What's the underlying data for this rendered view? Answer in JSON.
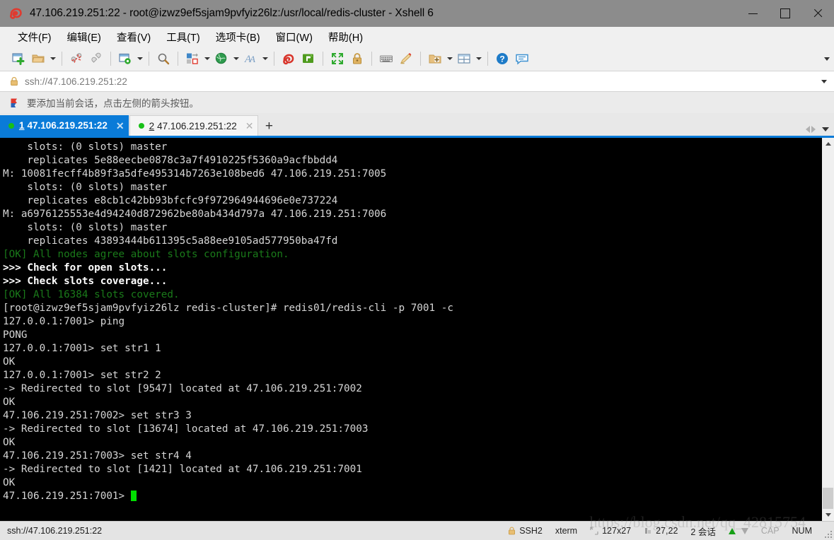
{
  "window": {
    "title": "47.106.219.251:22 - root@izwz9ef5sjam9pvfyiz26lz:/usr/local/redis-cluster - Xshell 6",
    "app_icon": "xshell-logo-icon",
    "minimize_label": "—",
    "maximize_label": "□",
    "close_label": "✕"
  },
  "menu": {
    "items": [
      {
        "label": "文件(F)",
        "name": "menu-file"
      },
      {
        "label": "编辑(E)",
        "name": "menu-edit"
      },
      {
        "label": "查看(V)",
        "name": "menu-view"
      },
      {
        "label": "工具(T)",
        "name": "menu-tools"
      },
      {
        "label": "选项卡(B)",
        "name": "menu-tabs"
      },
      {
        "label": "窗口(W)",
        "name": "menu-window"
      },
      {
        "label": "帮助(H)",
        "name": "menu-help"
      }
    ]
  },
  "toolbar": {
    "overflow_label": "▾",
    "buttons": [
      {
        "icon": "new-session-icon",
        "tooltip": "新建"
      },
      {
        "icon": "open-folder-icon",
        "tooltip": "打开"
      },
      {
        "icon": "disconnect-icon",
        "tooltip": "断开"
      },
      {
        "icon": "reconnect-icon",
        "tooltip": "重新连接"
      },
      {
        "icon": "session-properties-icon",
        "tooltip": "属性"
      },
      {
        "icon": "find-icon",
        "tooltip": "查找"
      },
      {
        "icon": "transfer-icon",
        "tooltip": "传输"
      },
      {
        "icon": "globe-icon",
        "tooltip": "浏览"
      },
      {
        "icon": "font-icon",
        "tooltip": "字体"
      },
      {
        "icon": "xshell-red-icon",
        "tooltip": "Xshell"
      },
      {
        "icon": "xftp-green-icon",
        "tooltip": "Xftp"
      },
      {
        "icon": "fullscreen-icon",
        "tooltip": "全屏"
      },
      {
        "icon": "lock-icon",
        "tooltip": "锁定"
      },
      {
        "icon": "keyboard-icon",
        "tooltip": "键盘"
      },
      {
        "icon": "highlight-pen-icon",
        "tooltip": "高亮"
      },
      {
        "icon": "add-folder-icon",
        "tooltip": "新建文件夹"
      },
      {
        "icon": "layout-split-icon",
        "tooltip": "排列"
      },
      {
        "icon": "help-icon",
        "tooltip": "帮助"
      },
      {
        "icon": "chat-icon",
        "tooltip": "聊天"
      }
    ]
  },
  "address_bar": {
    "icon": "lock-icon",
    "value": "ssh://47.106.219.251:22",
    "placeholder": "ssh://47.106.219.251:22",
    "dropdown_label": "▾"
  },
  "notice": {
    "icon": "bookmark-flag-icon",
    "text": "要添加当前会话，点击左侧的箭头按钮。"
  },
  "tabs": {
    "items": [
      {
        "number": "1",
        "label": "47.106.219.251:22",
        "active": true,
        "close_label": "✕",
        "status": "connected"
      },
      {
        "number": "2",
        "label": "47.106.219.251:22",
        "active": false,
        "close_label": "✕",
        "status": "connected"
      }
    ],
    "new_tab_label": "+",
    "nav_prev_label": "◀",
    "nav_next_label": "▶",
    "list_label": "▾"
  },
  "terminal": {
    "background": "#000000",
    "foreground": "#d6d6d6",
    "green": "#1a7a1a",
    "cursor_color": "#00e000",
    "lines": [
      {
        "text": "    slots: (0 slots) master",
        "color": "white"
      },
      {
        "text": "    replicates 5e88eecbe0878c3a7f4910225f5360a9acfbbdd4",
        "color": "white"
      },
      {
        "text": "M: 10081fecff4b89f3a5dfe495314b7263e108bed6 47.106.219.251:7005",
        "color": "white"
      },
      {
        "text": "    slots: (0 slots) master",
        "color": "white"
      },
      {
        "text": "    replicates e8cb1c42bb93bfcfc9f972964944696e0e737224",
        "color": "white"
      },
      {
        "text": "M: a6976125553e4d94240d872962be80ab434d797a 47.106.219.251:7006",
        "color": "white"
      },
      {
        "text": "    slots: (0 slots) master",
        "color": "white"
      },
      {
        "text": "    replicates 43893444b611395c5a88ee9105ad577950ba47fd",
        "color": "white"
      },
      {
        "text": "[OK] All nodes agree about slots configuration.",
        "color": "green"
      },
      {
        "text": ">>> Check for open slots...",
        "color": "bold"
      },
      {
        "text": ">>> Check slots coverage...",
        "color": "bold"
      },
      {
        "text": "[OK] All 16384 slots covered.",
        "color": "green"
      },
      {
        "text": "[root@izwz9ef5sjam9pvfyiz26lz redis-cluster]# redis01/redis-cli -p 7001 -c",
        "color": "white"
      },
      {
        "text": "127.0.0.1:7001> ping",
        "color": "white"
      },
      {
        "text": "PONG",
        "color": "white"
      },
      {
        "text": "127.0.0.1:7001> set str1 1",
        "color": "white"
      },
      {
        "text": "OK",
        "color": "white"
      },
      {
        "text": "127.0.0.1:7001> set str2 2",
        "color": "white"
      },
      {
        "text": "-> Redirected to slot [9547] located at 47.106.219.251:7002",
        "color": "white"
      },
      {
        "text": "OK",
        "color": "white"
      },
      {
        "text": "47.106.219.251:7002> set str3 3",
        "color": "white"
      },
      {
        "text": "-> Redirected to slot [13674] located at 47.106.219.251:7003",
        "color": "white"
      },
      {
        "text": "OK",
        "color": "white"
      },
      {
        "text": "47.106.219.251:7003> set str4 4",
        "color": "white"
      },
      {
        "text": "-> Redirected to slot [1421] located at 47.106.219.251:7001",
        "color": "white"
      },
      {
        "text": "OK",
        "color": "white"
      },
      {
        "text": "47.106.219.251:7001> ",
        "color": "white",
        "cursor": true
      }
    ]
  },
  "scrollbar": {
    "up_label": "▲",
    "down_label": "▼"
  },
  "statusbar": {
    "connection": "ssh://47.106.219.251:22",
    "security_icon": "lock-icon",
    "protocol": "SSH2",
    "terminal_type": "xterm",
    "size_icon": "screen-size-icon",
    "size": "127x27",
    "cursor_icon": "cursor-pos-icon",
    "cursor_pos": "27,22",
    "sessions": "2 会话",
    "upload_icon": "upload-arrow-icon",
    "download_icon": "download-arrow-icon",
    "caps": "CAP",
    "num": "NUM",
    "watermark": "https://blog.csdn.net/qq_42815754"
  }
}
